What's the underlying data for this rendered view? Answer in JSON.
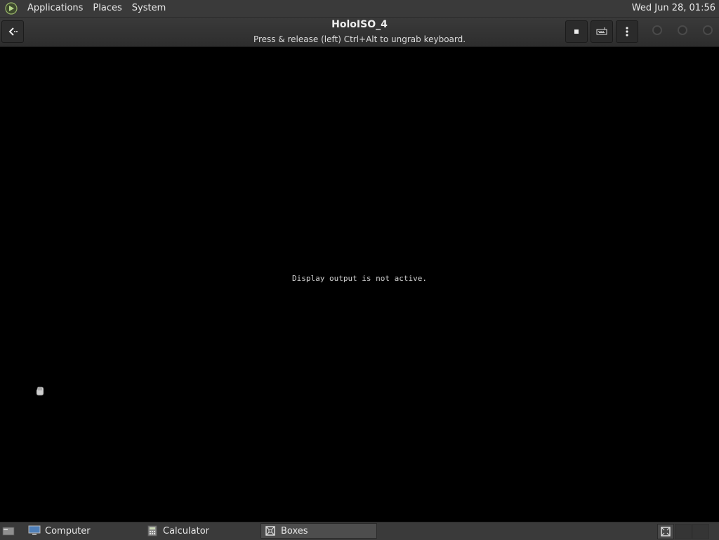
{
  "top_panel": {
    "menus": [
      "Applications",
      "Places",
      "System"
    ],
    "clock": "Wed Jun 28, 01:56"
  },
  "headerbar": {
    "title": "HoloISO_4",
    "subtitle": "Press & release (left) Ctrl+Alt to ungrab keyboard.",
    "buttons": [
      "back-icon",
      "stop-icon",
      "keyboard-icon",
      "menu-icon"
    ]
  },
  "vm": {
    "message": "Display output is not active."
  },
  "taskbar": {
    "tasks": [
      {
        "label": "Computer",
        "icon": "computer-icon",
        "active": false
      },
      {
        "label": "Calculator",
        "icon": "calculator-icon",
        "active": false
      },
      {
        "label": "Boxes",
        "icon": "boxes-icon",
        "active": true
      }
    ]
  },
  "colors": {
    "panel": "#3a3a3a",
    "background": "#000000",
    "text": "#e8e8e8"
  }
}
